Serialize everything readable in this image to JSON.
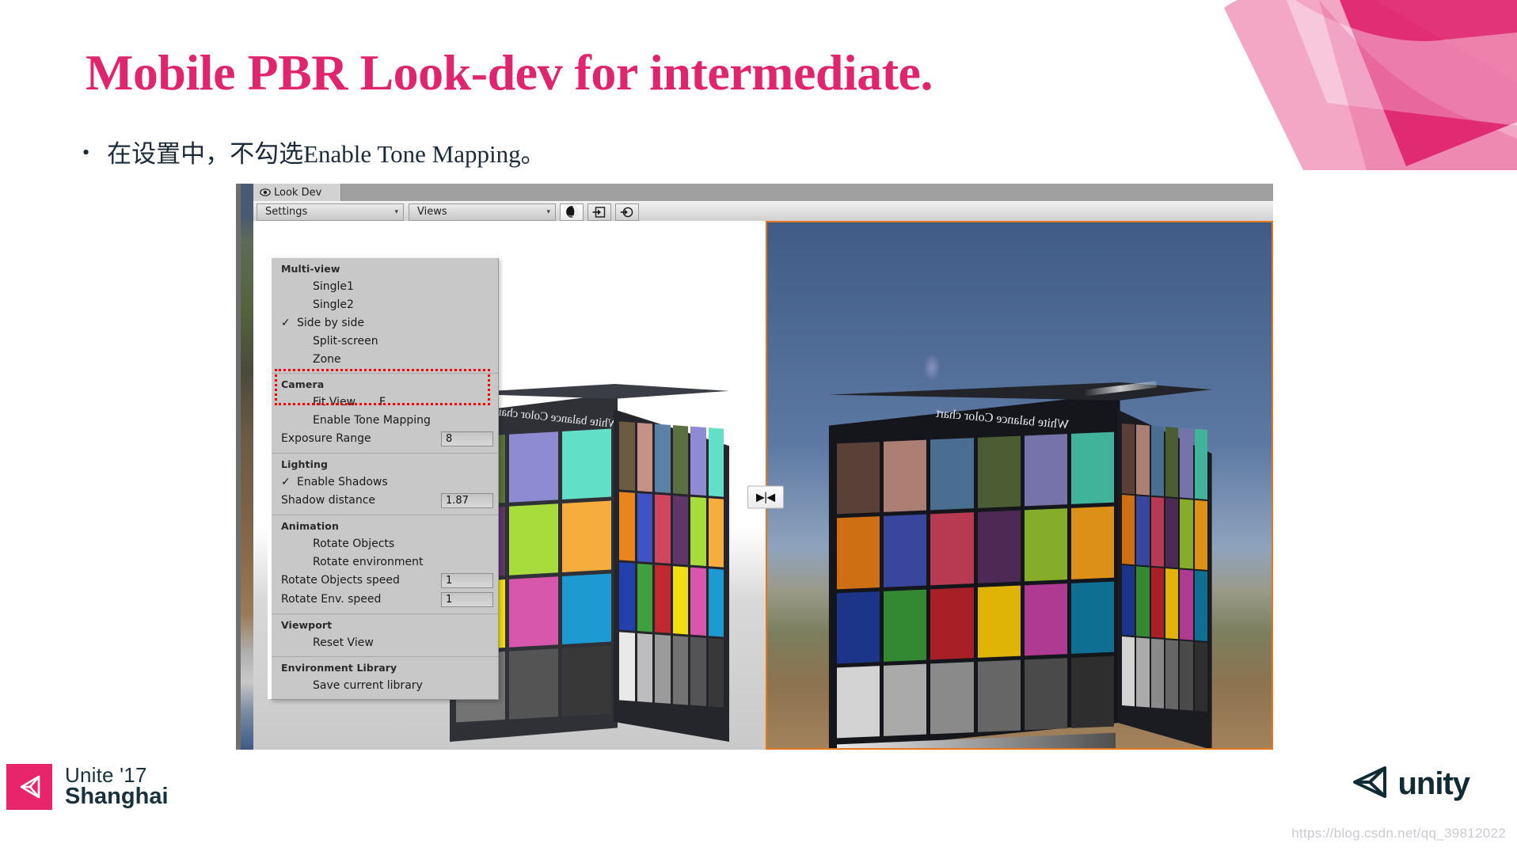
{
  "slide": {
    "title": "Mobile PBR Look-dev for intermediate.",
    "bullet_marker": "•",
    "bullet_text": "在设置中，不勾选Enable Tone Mapping。",
    "title_color": "#e0246e",
    "watermark": "https://blog.csdn.net/qq_39812022"
  },
  "footer": {
    "unite_line1": "Unite '17",
    "unite_line2": "Shanghai",
    "unity_word": "unity",
    "brand_pink": "#e8246b"
  },
  "editor": {
    "tab_label": "Look Dev",
    "toolbar": {
      "settings_label": "Settings",
      "views_label": "Views",
      "caret": "▾",
      "icons": [
        {
          "name": "shading-ball-icon",
          "title": "Shading ball"
        },
        {
          "name": "load-hdri-icon",
          "title": "Load HDRI"
        },
        {
          "name": "reload-hdri-icon",
          "title": "Reload HDRI"
        }
      ]
    },
    "splitter_glyph": "▶|◀",
    "menu": {
      "sections": [
        {
          "head": "Multi-view",
          "items": [
            {
              "check": "",
              "label": "Single1",
              "indent": true
            },
            {
              "check": "",
              "label": "Single2",
              "indent": true
            },
            {
              "check": "✓",
              "label": "Side by side",
              "indent": false
            },
            {
              "check": "",
              "label": "Split-screen",
              "indent": true
            },
            {
              "check": "",
              "label": "Zone",
              "indent": true
            }
          ]
        },
        {
          "head": "Camera",
          "items": [
            {
              "check": "",
              "label": "Fit View",
              "indent": true,
              "shortcut": "F"
            },
            {
              "check": "",
              "label": "Enable Tone Mapping",
              "indent": true
            }
          ],
          "fields": [
            {
              "label": "Exposure Range",
              "value": "8"
            }
          ]
        },
        {
          "head": "Lighting",
          "items": [
            {
              "check": "✓",
              "label": "Enable Shadows",
              "indent": false
            }
          ],
          "fields": [
            {
              "label": "Shadow distance",
              "value": "1.87"
            }
          ]
        },
        {
          "head": "Animation",
          "items": [
            {
              "check": "",
              "label": "Rotate Objects",
              "indent": true
            },
            {
              "check": "",
              "label": "Rotate environment",
              "indent": true
            }
          ],
          "fields": [
            {
              "label": "Rotate Objects speed",
              "value": "1"
            },
            {
              "label": "Rotate Env. speed",
              "value": "1"
            }
          ]
        },
        {
          "head": "Viewport",
          "items": [
            {
              "check": "",
              "label": "Reset View",
              "indent": true
            }
          ]
        },
        {
          "head": "Environment Library",
          "items": [
            {
              "check": "",
              "label": "Save current library",
              "indent": true
            }
          ]
        }
      ]
    },
    "scene": {
      "chart_title": "White balance Color chart",
      "left_view_label": "tone-mapping-off-view",
      "right_view_label": "tone-mapping-on-view",
      "selection_border_color": "#e8761a"
    }
  },
  "chart_data": {
    "type": "table",
    "title": "White balance Color chart",
    "note": "24-patch colour-checker rendered on a 3D box in both Look Dev views",
    "columns": 6,
    "rows": 4,
    "right_view_swatches": [
      [
        "#5a4036",
        "#ab7f73",
        "#4a6e8f",
        "#4c5c33",
        "#7673ab",
        "#42b39b"
      ],
      [
        "#ce6f14",
        "#38479d",
        "#b83a52",
        "#4d2a53",
        "#86ad2a",
        "#dc9016"
      ],
      [
        "#1d3588",
        "#338832",
        "#a82026",
        "#e0b407",
        "#ae3b91",
        "#0f6f92"
      ],
      [
        "#d3d3d3",
        "#aaaaaa",
        "#8a8a8a",
        "#666666",
        "#4a4a4a",
        "#2e2e2e"
      ]
    ],
    "left_view_swatches": [
      [
        "#6d5a42",
        "#c49287",
        "#5b82a4",
        "#5b7040",
        "#8f8bd2",
        "#62e0c7"
      ],
      [
        "#e8851c",
        "#3f54c2",
        "#d0465f",
        "#5e3668",
        "#a8db3c",
        "#f7ad3e"
      ],
      [
        "#2340ad",
        "#3fa13d",
        "#c2282f",
        "#f2de15",
        "#d757ac",
        "#1e9ad2"
      ],
      [
        "#e9e9e9",
        "#bdbdbd",
        "#9a9a9a",
        "#737373",
        "#545454",
        "#383838"
      ]
    ]
  }
}
